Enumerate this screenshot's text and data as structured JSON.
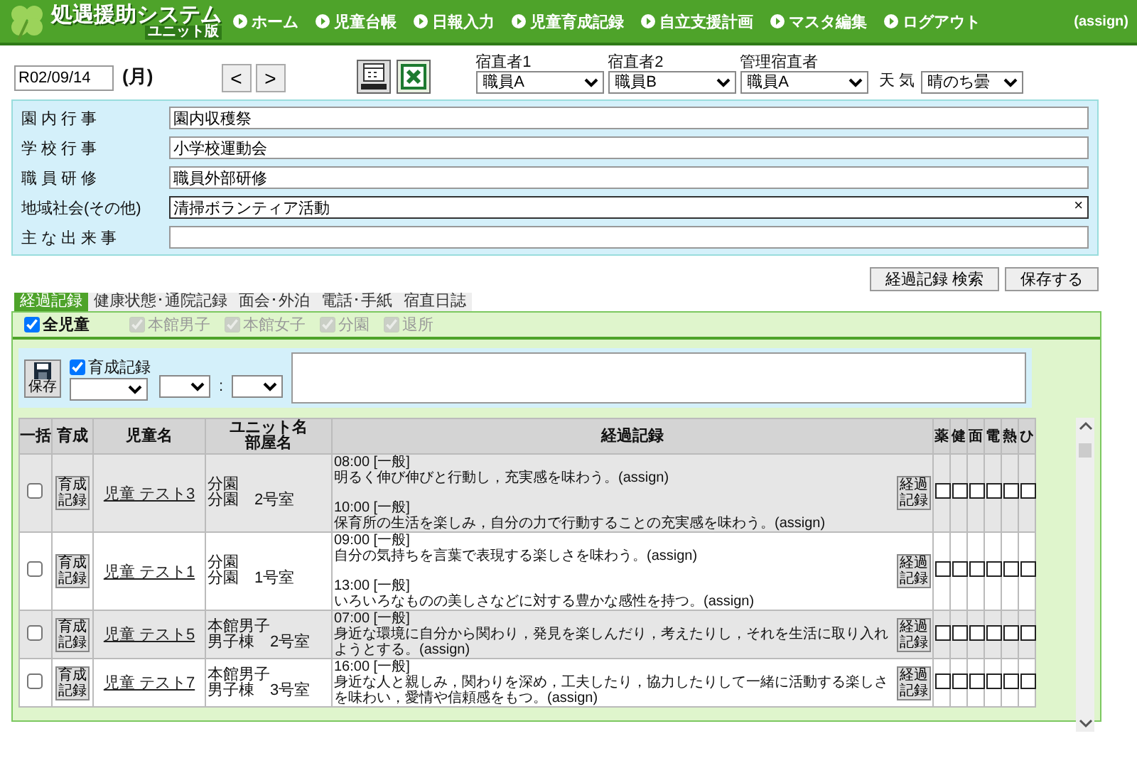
{
  "header": {
    "title": "処遇援助システム",
    "subtitle": "ユニット版",
    "nav": [
      "ホーム",
      "児童台帳",
      "日報入力",
      "児童育成記録",
      "自立支援計画",
      "マスタ編集",
      "ログアウト"
    ],
    "user": "(assign)"
  },
  "toolbar": {
    "date": "R02/09/14",
    "weekday": "(月)",
    "prev": "<",
    "next": ">",
    "staff": [
      {
        "label": "宿直者1",
        "value": "職員A"
      },
      {
        "label": "宿直者2",
        "value": "職員B"
      },
      {
        "label": "管理宿直者",
        "value": "職員A"
      }
    ],
    "weather": {
      "label": "天 気",
      "value": "晴のち曇"
    }
  },
  "events": [
    {
      "label": "園 内 行 事",
      "value": "園内収穫祭",
      "focused": false
    },
    {
      "label": "学 校 行 事",
      "value": "小学校運動会",
      "focused": false
    },
    {
      "label": "職 員 研 修",
      "value": "職員外部研修",
      "focused": false
    },
    {
      "label": "地域社会(その他)",
      "value": "清掃ボランティア活動",
      "focused": true,
      "clear": "×"
    },
    {
      "label": "主 な 出 来 事",
      "focused": false
    }
  ],
  "actions": [
    "経過記録 検索",
    "保存する"
  ],
  "tabs": [
    {
      "label": "経過記録",
      "selected": true
    },
    {
      "label": "健康状態･通院記録",
      "selected": false
    },
    {
      "label": "面会･外泊",
      "selected": false
    },
    {
      "label": "電話･手紙",
      "selected": false
    },
    {
      "label": "宿直日誌",
      "selected": false
    }
  ],
  "filters": [
    {
      "label": "全児童",
      "checked": true,
      "disabled": false
    },
    {
      "label": "本館男子",
      "checked": true,
      "disabled": true
    },
    {
      "label": "本館女子",
      "checked": true,
      "disabled": true
    },
    {
      "label": "分園",
      "checked": true,
      "disabled": true
    },
    {
      "label": "退所",
      "checked": true,
      "disabled": true
    }
  ],
  "entry": {
    "save": "保存",
    "record": {
      "label": "育成記録",
      "checked": true
    },
    "separator": ":"
  },
  "table": {
    "columns": [
      {
        "lines": [
          "一括"
        ]
      },
      {
        "lines": [
          "育成"
        ]
      },
      {
        "lines": [
          "児童名"
        ]
      },
      {
        "lines": [
          "ユニット名",
          "部屋名"
        ]
      },
      {
        "lines": [
          "経過記録"
        ]
      },
      {
        "lines": [
          "薬"
        ]
      },
      {
        "lines": [
          "健"
        ]
      },
      {
        "lines": [
          "面"
        ]
      },
      {
        "lines": [
          "電"
        ]
      },
      {
        "lines": [
          "熱"
        ]
      },
      {
        "lines": [
          "ひ"
        ]
      }
    ],
    "rows": [
      {
        "checked": false,
        "record_button": [
          "育成",
          "記録"
        ],
        "name": "児童 テスト3",
        "unit": "分園",
        "room": "分園　2号室",
        "entries": [
          {
            "time": "08:00 [一般]",
            "text": "明るく伸び伸びと行動し，充実感を味わう。(assign)"
          },
          {
            "time": "10:00 [一般]",
            "text": "保育所の生活を楽しみ，自分の力で行動することの充実感を味わう。(assign)"
          }
        ],
        "log_button": [
          "経過",
          "記録"
        ],
        "flags": [
          false,
          false,
          false,
          false,
          false,
          false
        ]
      },
      {
        "checked": false,
        "record_button": [
          "育成",
          "記録"
        ],
        "name": "児童 テスト1",
        "unit": "分園",
        "room": "分園　1号室",
        "entries": [
          {
            "time": "09:00 [一般]",
            "text": "自分の気持ちを言葉で表現する楽しさを味わう。(assign)"
          },
          {
            "time": "13:00 [一般]",
            "text": "いろいろなものの美しさなどに対する豊かな感性を持つ。(assign)"
          }
        ],
        "log_button": [
          "経過",
          "記録"
        ],
        "flags": [
          false,
          false,
          false,
          false,
          false,
          false
        ]
      },
      {
        "checked": false,
        "record_button": [
          "育成",
          "記録"
        ],
        "name": "児童 テスト5",
        "unit": "本館男子",
        "room": "男子棟　2号室",
        "entries": [
          {
            "time": "07:00 [一般]",
            "text": "身近な環境に自分から関わり，発見を楽しんだり，考えたりし，それを生活に取り入れようとする。(assign)"
          }
        ],
        "log_button": [
          "経過",
          "記録"
        ],
        "flags": [
          false,
          false,
          false,
          false,
          false,
          false
        ]
      },
      {
        "checked": false,
        "record_button": [
          "育成",
          "記録"
        ],
        "name": "児童 テスト7",
        "unit": "本館男子",
        "room": "男子棟　3号室",
        "entries": [
          {
            "time": "16:00 [一般]",
            "text": "身近な人と親しみ，関わりを深め，工夫したり，協力したりして一緒に活動する楽しさを味わい，愛情や信頼感をもつ。(assign)"
          }
        ],
        "log_button": [
          "経過",
          "記録"
        ],
        "flags": [
          false,
          false,
          false,
          false,
          false,
          false
        ]
      }
    ]
  }
}
